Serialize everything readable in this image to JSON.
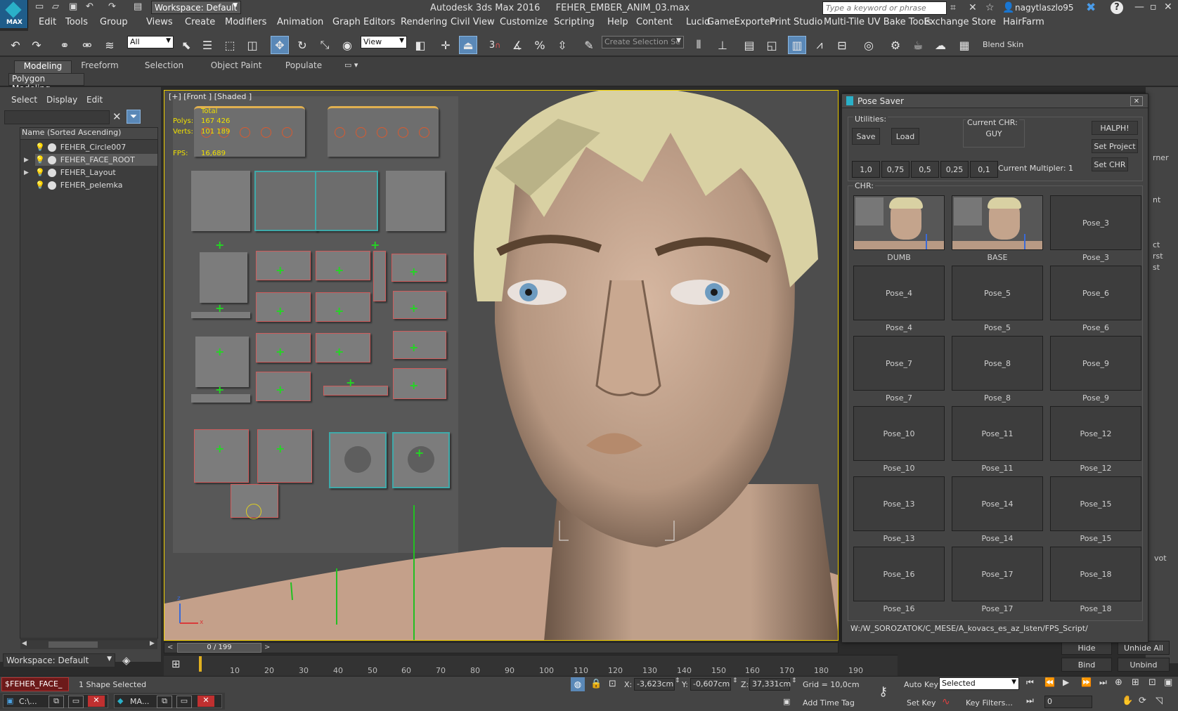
{
  "titlebar": {
    "app_title": "Autodesk 3ds Max 2016",
    "file_title": "FEHER_EMBER_ANIM_03.max",
    "workspace": "Workspace: Default",
    "search_placeholder": "Type a keyword or phrase",
    "user": "nagytlaszlo95",
    "max_logo": "MAX"
  },
  "menu": [
    "Edit",
    "Tools",
    "Group",
    "Views",
    "Create",
    "Modifiers",
    "Animation",
    "Graph Editors",
    "Rendering",
    "Civil View",
    "Customize",
    "Scripting",
    "Help",
    "Content",
    "Lucid",
    "GameExporter",
    "Print Studio",
    "Multi-Tile UV Bake Tools",
    "Exchange Store",
    "HairFarm"
  ],
  "toolbar": {
    "filter_value": "All",
    "coord_value": "View",
    "selection_set_placeholder": "Create Selection Se",
    "snap_label": "3",
    "blend_skin": "Blend Skin"
  },
  "ribbon": {
    "tabs": [
      "Modeling",
      "Freeform",
      "Selection",
      "Object Paint",
      "Populate"
    ],
    "sub_label": "Polygon Modeling"
  },
  "scene_explorer": {
    "menus": [
      "Select",
      "Display",
      "Edit"
    ],
    "column_header": "Name (Sorted Ascending)",
    "items": [
      "FEHER_Circle007",
      "FEHER_FACE_ROOT",
      "FEHER_Layout",
      "FEHER_pelemka"
    ],
    "workspace": "Workspace: Default"
  },
  "viewport": {
    "label": "[+] [Front ] [Shaded ]",
    "stats": {
      "total_label": "Total",
      "polys_label": "Polys:",
      "polys_value": "167 426",
      "verts_label": "Verts:",
      "verts_value": "101 189",
      "fps_label": "FPS:",
      "fps_value": "16,689"
    },
    "axis_z": "z",
    "axis_x": "x"
  },
  "pose_saver": {
    "title": "Pose Saver",
    "utilities_label": "Utilities:",
    "save": "Save",
    "load": "Load",
    "current_chr_label": "Current CHR:",
    "current_chr_value": "GUY",
    "halph": "HALPH!",
    "set_project": "Set Project",
    "set_chr": "Set CHR",
    "multipliers": [
      "1,0",
      "0,75",
      "0,5",
      "0,25",
      "0,1"
    ],
    "current_multiplier_label": "Current Multipler:",
    "current_multiplier_value": "1",
    "chr_label": "CHR:",
    "poses": [
      {
        "button": "",
        "label": "DUMB",
        "thumb": true
      },
      {
        "button": "",
        "label": "BASE",
        "thumb": true
      },
      {
        "button": "Pose_3",
        "label": "Pose_3"
      },
      {
        "button": "Pose_4",
        "label": "Pose_4"
      },
      {
        "button": "Pose_5",
        "label": "Pose_5"
      },
      {
        "button": "Pose_6",
        "label": "Pose_6"
      },
      {
        "button": "Pose_7",
        "label": "Pose_7"
      },
      {
        "button": "Pose_8",
        "label": "Pose_8"
      },
      {
        "button": "Pose_9",
        "label": "Pose_9"
      },
      {
        "button": "Pose_10",
        "label": "Pose_10"
      },
      {
        "button": "Pose_11",
        "label": "Pose_11"
      },
      {
        "button": "Pose_12",
        "label": "Pose_12"
      },
      {
        "button": "Pose_13",
        "label": "Pose_13"
      },
      {
        "button": "Pose_14",
        "label": "Pose_14"
      },
      {
        "button": "Pose_15",
        "label": "Pose_15"
      },
      {
        "button": "Pose_16",
        "label": "Pose_16"
      },
      {
        "button": "Pose_17",
        "label": "Pose_17"
      },
      {
        "button": "Pose_18",
        "label": "Pose_18"
      }
    ],
    "path": "W:/W_SOROZATOK/C_MESE/A_kovacs_es_az_Isten/FPS_Script/"
  },
  "right_panel": {
    "partial_texts": [
      "rner",
      "nt",
      "ct",
      "rst",
      "st",
      "vot"
    ],
    "hide": "Hide",
    "unhide_all": "Unhide All",
    "bind": "Bind",
    "unbind": "Unbind"
  },
  "timeline": {
    "frame_counter": "0 / 199",
    "ticks": [
      "10",
      "20",
      "30",
      "40",
      "50",
      "60",
      "70",
      "80",
      "90",
      "100",
      "110",
      "120",
      "130",
      "140",
      "150",
      "160",
      "170",
      "180",
      "190"
    ]
  },
  "status": {
    "selection_button": "$FEHER_FACE_",
    "message": "1 Shape Selected",
    "x_label": "X:",
    "x_value": "-3,623cm",
    "y_label": "Y:",
    "y_value": "-0,607cm",
    "z_label": "Z:",
    "z_value": "37,331cm",
    "grid": "Grid = 10,0cm",
    "add_time_tag": "Add Time Tag",
    "auto_key": "Auto Key",
    "set_key": "Set Key",
    "selected_value": "Selected",
    "key_filters": "Key Filters...",
    "frame_value": "0"
  },
  "taskbar": {
    "items": [
      "C:\\...",
      "MA..."
    ]
  }
}
